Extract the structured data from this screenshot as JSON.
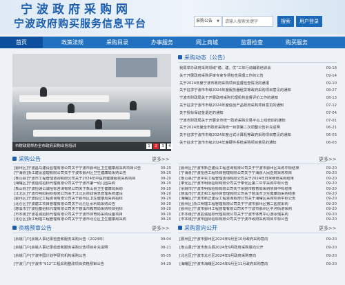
{
  "header": {
    "title1": "宁波政府采购网",
    "title2": "宁波政府购买服务信息平台",
    "search_select": "采购公告",
    "search_placeholder": "请输入搜索关键字",
    "search_btn": "搜索",
    "login_btn": "用户登录"
  },
  "nav": [
    "首页",
    "政策法规",
    "采购目录",
    "办事服务",
    "网上商城",
    "监督检查",
    "购买服务"
  ],
  "carousel": {
    "caption": "市财政局举办全市政府采购业务培训",
    "pages": [
      "1",
      "2",
      "3",
      "4"
    ]
  },
  "news": {
    "title": "采购动态（公告）",
    "more": "更多>>",
    "items": [
      {
        "t": "我局举办政府采购领域“稳、建、优”三年行动辅助培训会",
        "d": "09-18"
      },
      {
        "t": "关于开展政府采购评审专家专项检查清理工作的公告",
        "d": "09-14"
      },
      {
        "t": "关于2024年度宁波市政府采购项目监督检查情况的通报",
        "d": "09-10"
      },
      {
        "t": "关于征求宁波市市级2024年度服务器租赁等政府采购项目意见的通知",
        "d": "08-27"
      },
      {
        "t": "宁波市财政局关于开展政府采购代理机构监督评价工作的通知",
        "d": "08-13"
      },
      {
        "t": "关于征求宁波市市级2024年度信创产品政府采购项目意见的通知",
        "d": "07-12"
      },
      {
        "t": "关于投标保证金退还的通知",
        "d": "07-04"
      },
      {
        "t": "宁波市财政局关于开展全市统一政府采购交易平台上线培训的通知",
        "d": "07-01"
      },
      {
        "t": "关于2024年度全市政府采购统一目录第二次调整公告补充说明",
        "d": "06-21"
      },
      {
        "t": "关于征求宁波市市级2024年度台式计算机等政府采购项目意见的通知",
        "d": "06-03"
      },
      {
        "t": "关于征求宁波市市级2024年度硬件系统采购项目意见的通知",
        "d": "06-03"
      }
    ]
  },
  "purchase": {
    "title": "采购公告",
    "more": "更多>>",
    "items": [
      {
        "t": "[鄞州区]宁波昌马建设监理有限公司关于宁波市鄞州区卫生健康局采购项目公告",
        "d": "09-20"
      },
      {
        "t": "[宁海县]浙江建设监理有限公司关于宁波市鄞州区卫生健康局采购公告",
        "d": "09-20"
      },
      {
        "t": "[象山县]宁波市工程管理咨询有限公司关于2024年中医药健康服务采购项目",
        "d": "09-20"
      },
      {
        "t": "[海曙区]宁波造成招标代理有限公司关于宁波市第一幼儿园采购",
        "d": "09-20"
      },
      {
        "t": "[象山县]宁波恒通公诚招标咨询有限公司关于象山县卫生健康局采购",
        "d": "09-20"
      },
      {
        "t": "[江北区]宁波市明阳招标有限公司关于江北区财政信息管理系统建设",
        "d": "09-20"
      },
      {
        "t": "[鄞州区]宁波恒亿工程咨询有限公司关于鄞州区卫生健康局采购招标",
        "d": "09-20"
      },
      {
        "t": "[北仑区]宁波建工项目管理有限公司关于北仑区水利局采购公告",
        "d": "09-20"
      },
      {
        "t": "[慈溪市]宁波恒基招标代理有限公司关于慈溪市教育局采购项目招标",
        "d": "09-20"
      },
      {
        "t": "[市本级]宁波名诚招标代理有限公司关于宁波市体育局采购设备项目",
        "d": "09-20"
      },
      {
        "t": "[北仑区]浙江明理工程管理有限公司关于宁波市北仑区卫生健康局采购",
        "d": "09-20"
      }
    ]
  },
  "result": {
    "more": "更多>>",
    "items": [
      {
        "t": "[鄞州区]宁波市新正建设工程咨询有限公司关于宁波市鄞州区采购中标结果",
        "d": "09-20"
      },
      {
        "t": "[宁海县]宁波恒信工程项目管理有限公司关于宁海县人民医院采购项目",
        "d": "09-20"
      },
      {
        "t": "[象山县]宁波中实工程管理咨询有限公司关于2024年日常维修采购结果",
        "d": "09-20"
      },
      {
        "t": "[奉化区]宁波市明阳招标有限公司关于奉化区第二中学采购中标公告",
        "d": "09-20"
      },
      {
        "t": "[余姚市]宁波市明阳招标有限公司关于余姚市教育局采购项目中标结果",
        "d": "09-20"
      },
      {
        "t": "[慈溪市]宁波正和工程项目管理有限公司关于慈溪市卫生健康局采购结果",
        "d": "09-20"
      },
      {
        "t": "[海曙区]宁波市新正建设工程咨询有限公司关于海曙区采购项目中标公告",
        "d": "09-20"
      },
      {
        "t": "[鄞州区]浙江明理工程管理有限公司关于宁波市鄞州区第二医院采购",
        "d": "09-20"
      },
      {
        "t": "[鄞州区]宁波市鄞州工程管理有限公司关于宁波市鄞州区中河街道采购",
        "d": "09-20"
      },
      {
        "t": "[市本级]宁波名诚招标代理有限公司关于宁波市体育中心游泳馆采购",
        "d": "09-20"
      },
      {
        "t": "[市本级]宁波市国际招标有限公司关于宁波市政府采购项目中标公告",
        "d": "09-20"
      }
    ]
  },
  "qual": {
    "title": "资格预审公告",
    "more": "更多>>",
    "items": [
      {
        "t": "[余姚门户]余姚人事记录检查和服务采购公告（2024年）",
        "d": "09-04"
      },
      {
        "t": "[余姚门户]余姚人事记录检查和服务采购公告项目补充说明",
        "d": "08-21"
      },
      {
        "t": "[余姚门户]宁波中国计划学研究机构采购公告",
        "d": "05-05"
      },
      {
        "t": "[宁波门户]宁波市“912”工程采购整改项目资格预审公告",
        "d": "04-29"
      }
    ]
  },
  "intent": {
    "title": "采购意向公开",
    "more": "更多>>",
    "items": [
      {
        "t": "[鄞州区]宁波市鄞州区2024年9月至10月政府采购意向",
        "d": "09-20"
      },
      {
        "t": "[象山县]宁波市象山县2024年9月政府采购意向公开",
        "d": "09-20"
      },
      {
        "t": "[北仑区]宁波市北仑区2024年9月政府采购意向",
        "d": "09-20"
      },
      {
        "t": "[海曙区]宁波市海曙区2024年9月至11月政府采购意向",
        "d": "09-20"
      }
    ]
  }
}
